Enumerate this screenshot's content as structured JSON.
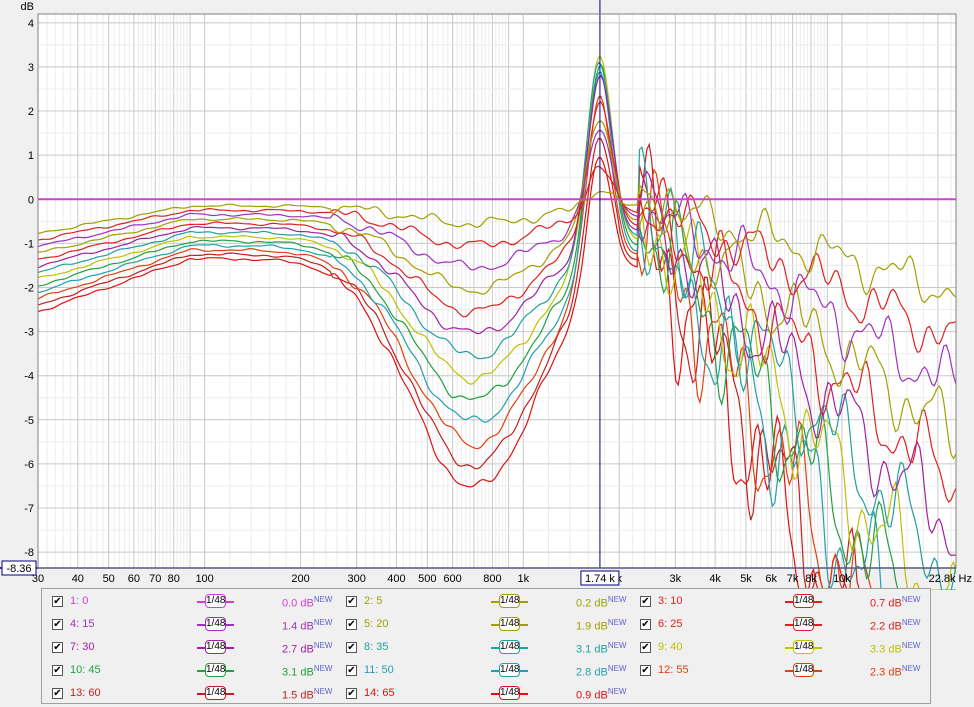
{
  "chart_data": {
    "type": "line",
    "xscale": "log",
    "xlim": [
      30,
      22800
    ],
    "ylim": [
      -8.36,
      4.2
    ],
    "xunit": "Hz",
    "yunit": "dB",
    "cursor": {
      "x_label": "1.74 k",
      "y_label": "-8.36",
      "x_value": 1740
    },
    "x_ticks": [
      {
        "v": 30,
        "l": "30"
      },
      {
        "v": 40,
        "l": "40"
      },
      {
        "v": 50,
        "l": "50"
      },
      {
        "v": 60,
        "l": "60"
      },
      {
        "v": 70,
        "l": "70"
      },
      {
        "v": 80,
        "l": "80"
      },
      {
        "v": 100,
        "l": "100"
      },
      {
        "v": 200,
        "l": "200"
      },
      {
        "v": 300,
        "l": "300"
      },
      {
        "v": 400,
        "l": "400"
      },
      {
        "v": 500,
        "l": "500"
      },
      {
        "v": 600,
        "l": "600"
      },
      {
        "v": 800,
        "l": "800"
      },
      {
        "v": 1000,
        "l": "1k"
      },
      {
        "v": 2000,
        "l": "k"
      },
      {
        "v": 3000,
        "l": "3k"
      },
      {
        "v": 4000,
        "l": "4k"
      },
      {
        "v": 5000,
        "l": "5k"
      },
      {
        "v": 6000,
        "l": "6k"
      },
      {
        "v": 7000,
        "l": "7k"
      },
      {
        "v": 8000,
        "l": "8k"
      },
      {
        "v": 10000,
        "l": "10k"
      },
      {
        "v": 22800,
        "l": "22.8k Hz"
      }
    ],
    "y_ticks": [
      4,
      3,
      2,
      1,
      0,
      -1,
      -2,
      -3,
      -4,
      -5,
      -6,
      -7,
      -8
    ],
    "series": [
      {
        "name": "1: 0",
        "offset": "0.0 dB",
        "color": "#d040d0",
        "max": 0.0
      },
      {
        "name": "2: 5",
        "offset": "0.2 dB",
        "color": "#a0a000",
        "max": 0.25
      },
      {
        "name": "3: 10",
        "offset": "0.7 dB",
        "color": "#e02020",
        "max": 0.7
      },
      {
        "name": "4: 15",
        "offset": "1.4 dB",
        "color": "#a030c0",
        "max": 1.5
      },
      {
        "name": "5: 20",
        "offset": "1.9 dB",
        "color": "#a0a000",
        "max": 1.9
      },
      {
        "name": "6: 25",
        "offset": "2.2 dB",
        "color": "#e02020",
        "max": 2.2
      },
      {
        "name": "7: 30",
        "offset": "2.7 dB",
        "color": "#a020a0",
        "max": 2.7
      },
      {
        "name": "8: 35",
        "offset": "3.1 dB",
        "color": "#20a0a0",
        "max": 3.1
      },
      {
        "name": "9: 40",
        "offset": "3.3 dB",
        "color": "#c0c000",
        "max": 3.3
      },
      {
        "name": "10: 45",
        "offset": "3.1 dB",
        "color": "#20a040",
        "max": 3.1
      },
      {
        "name": "11: 50",
        "offset": "2.8 dB",
        "color": "#20a0b0",
        "max": 2.8
      },
      {
        "name": "12: 55",
        "offset": "2.3 dB",
        "color": "#e04010",
        "max": 2.3
      },
      {
        "name": "13: 60",
        "offset": "1.5 dB",
        "color": "#c02020",
        "max": 1.5
      },
      {
        "name": "14: 65",
        "offset": "0.9 dB",
        "color": "#e01010",
        "max": 0.9
      }
    ]
  },
  "legend": {
    "smoothing_label": "1/48",
    "new_badge": "NEW"
  }
}
